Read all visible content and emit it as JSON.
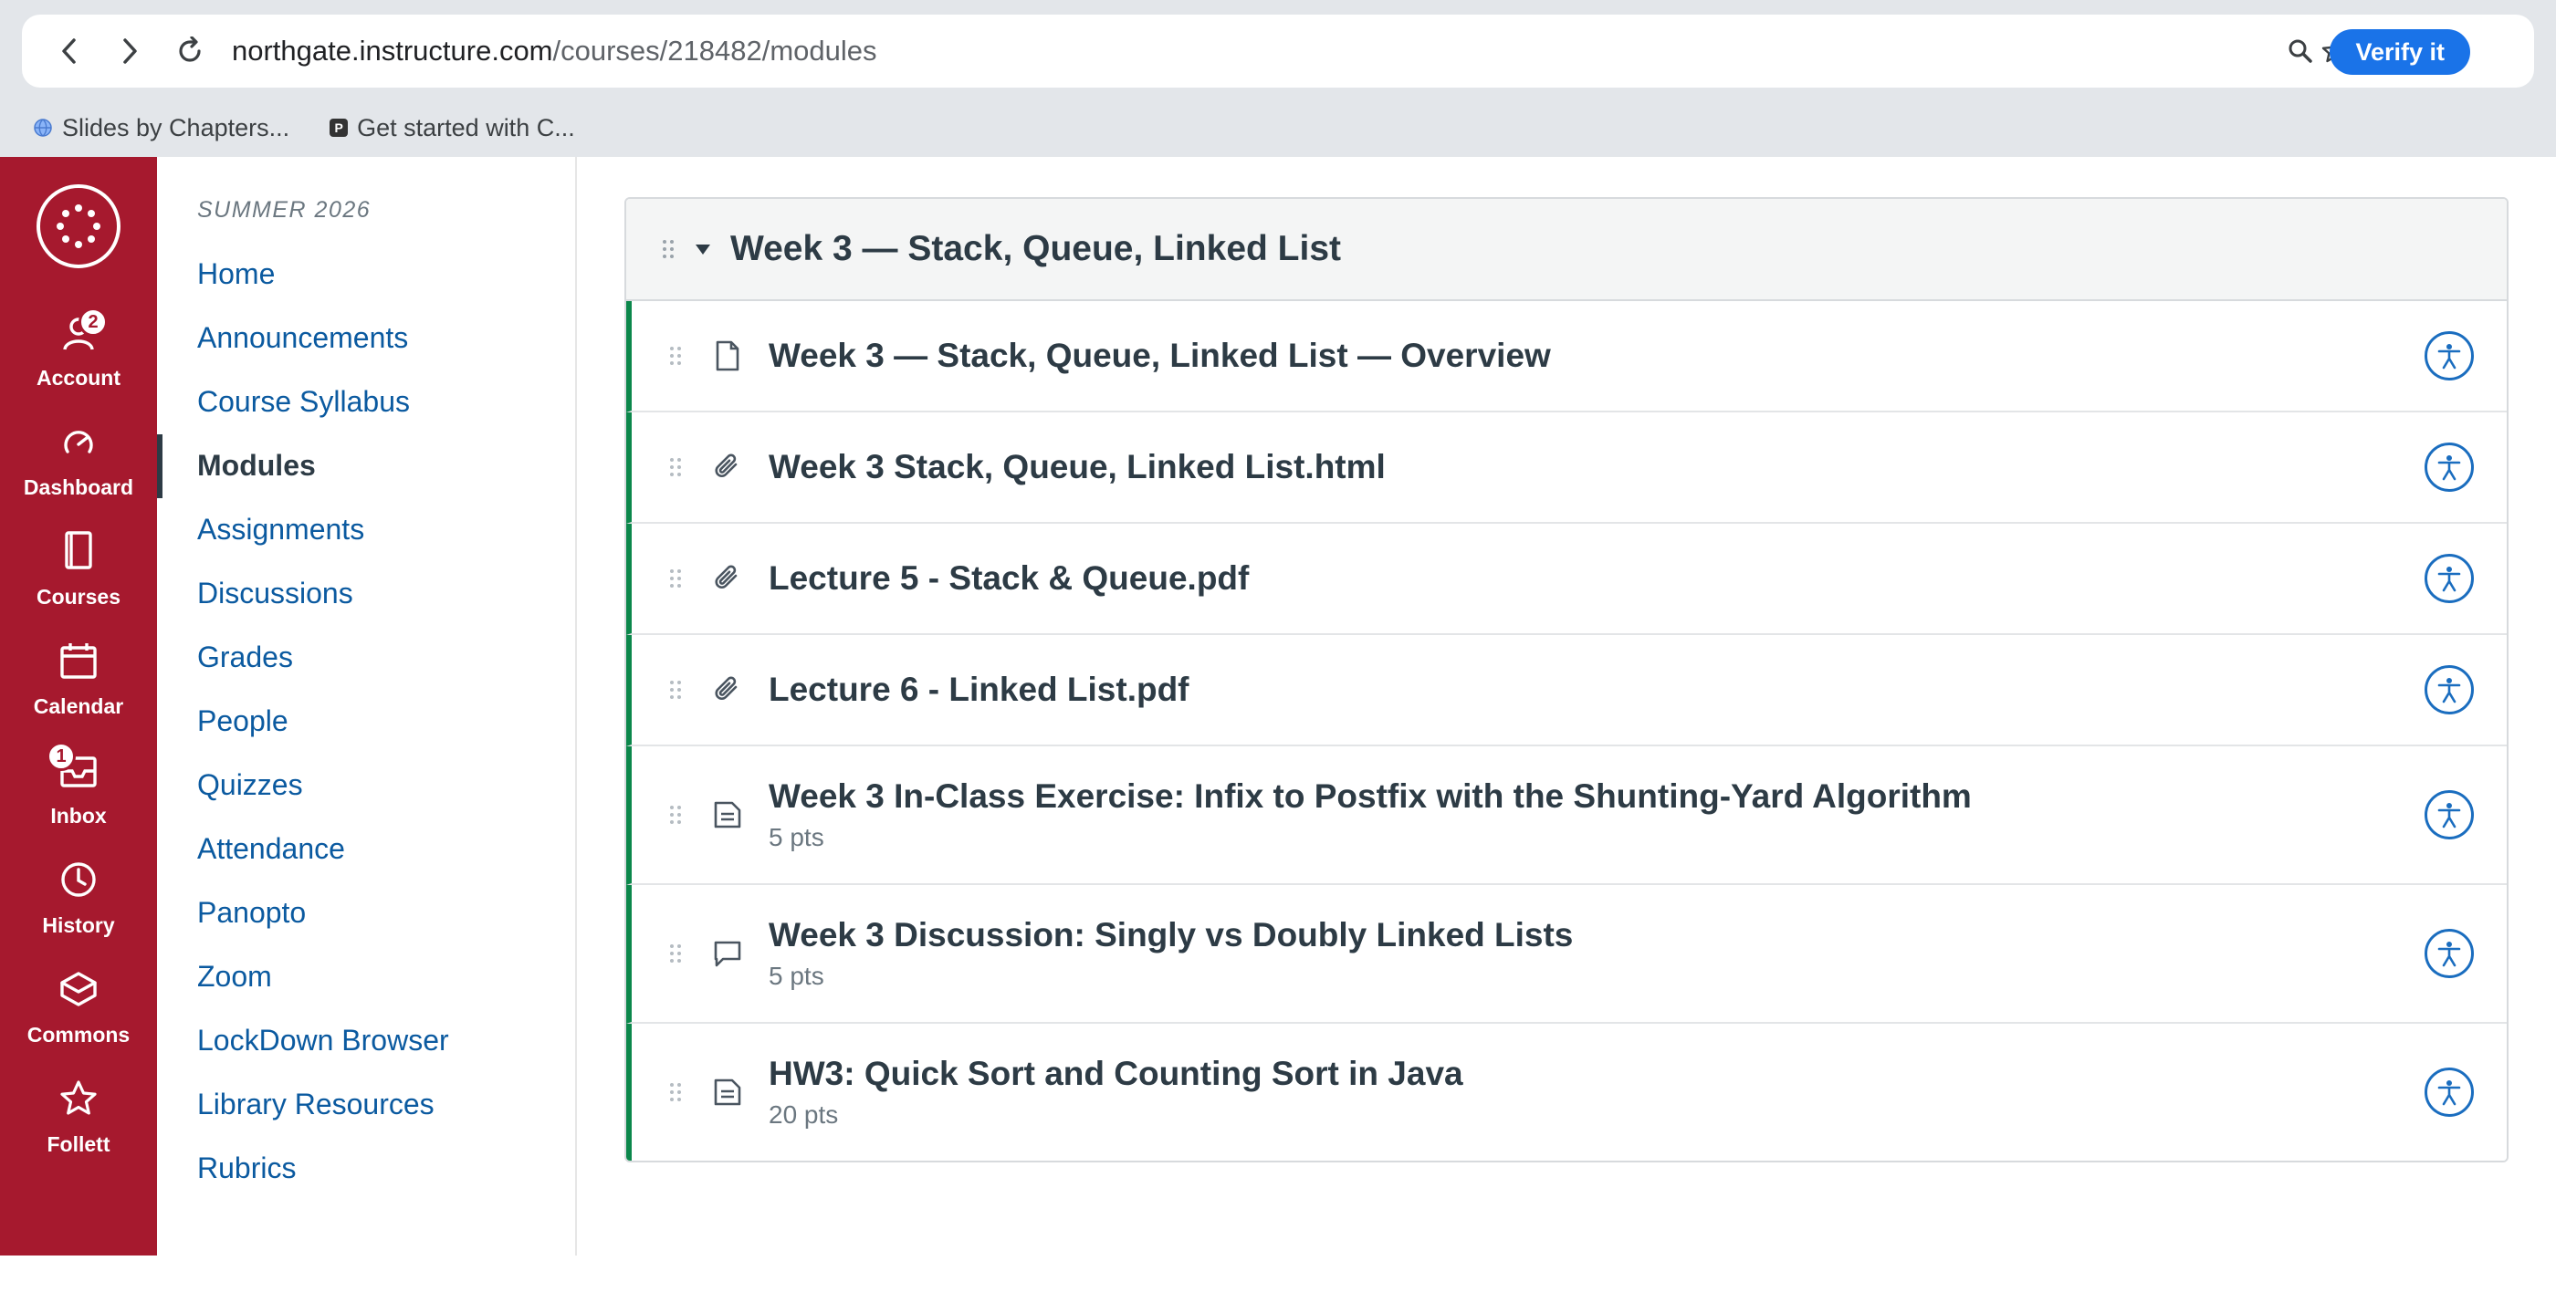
{
  "browser": {
    "url_host": "northgate.instructure.com",
    "url_path": "/courses/218482/modules",
    "verify_label": "Verify it",
    "bookmarks": [
      {
        "label": "Slides by Chapters...",
        "icon": "globe-icon"
      },
      {
        "label": "Get started with C...",
        "icon": "p-icon"
      }
    ]
  },
  "global_nav": {
    "items": [
      {
        "label": "Account",
        "icon": "account-icon",
        "badge": "2"
      },
      {
        "label": "Dashboard",
        "icon": "dashboard-icon"
      },
      {
        "label": "Courses",
        "icon": "courses-icon"
      },
      {
        "label": "Calendar",
        "icon": "calendar-icon"
      },
      {
        "label": "Inbox",
        "icon": "inbox-icon",
        "badge": "1"
      },
      {
        "label": "History",
        "icon": "history-icon"
      },
      {
        "label": "Commons",
        "icon": "commons-icon"
      },
      {
        "label": "Follett",
        "icon": "star-icon"
      }
    ],
    "accent": "#a6192e"
  },
  "course_nav": {
    "term": "SUMMER 2026",
    "items": [
      {
        "label": "Home"
      },
      {
        "label": "Announcements"
      },
      {
        "label": "Course Syllabus"
      },
      {
        "label": "Modules",
        "active": true
      },
      {
        "label": "Assignments"
      },
      {
        "label": "Discussions"
      },
      {
        "label": "Grades"
      },
      {
        "label": "People"
      },
      {
        "label": "Quizzes"
      },
      {
        "label": "Attendance"
      },
      {
        "label": "Panopto"
      },
      {
        "label": "Zoom"
      },
      {
        "label": "LockDown Browser"
      },
      {
        "label": "Library Resources"
      },
      {
        "label": "Rubrics"
      }
    ]
  },
  "module": {
    "title": "Week 3 — Stack, Queue, Linked List",
    "items": [
      {
        "title": "Week 3 — Stack, Queue, Linked List — Overview",
        "icon": "page-icon",
        "points": ""
      },
      {
        "title": "Week 3 Stack, Queue, Linked List.html",
        "icon": "attachment-icon",
        "points": ""
      },
      {
        "title": "Lecture 5 - Stack & Queue.pdf",
        "icon": "attachment-icon",
        "points": ""
      },
      {
        "title": "Lecture 6 - Linked List.pdf",
        "icon": "attachment-icon",
        "points": ""
      },
      {
        "title": "Week 3 In-Class Exercise: Infix to Postfix with the Shunting-Yard Algorithm",
        "icon": "assignment-icon",
        "points": "5 pts"
      },
      {
        "title": "Week 3 Discussion: Singly vs Doubly Linked Lists",
        "icon": "discussion-icon",
        "points": "5 pts"
      },
      {
        "title": "HW3: Quick Sort and Counting Sort in Java",
        "icon": "assignment-icon",
        "points": "20 pts"
      }
    ],
    "published_color": "#0b874b"
  }
}
